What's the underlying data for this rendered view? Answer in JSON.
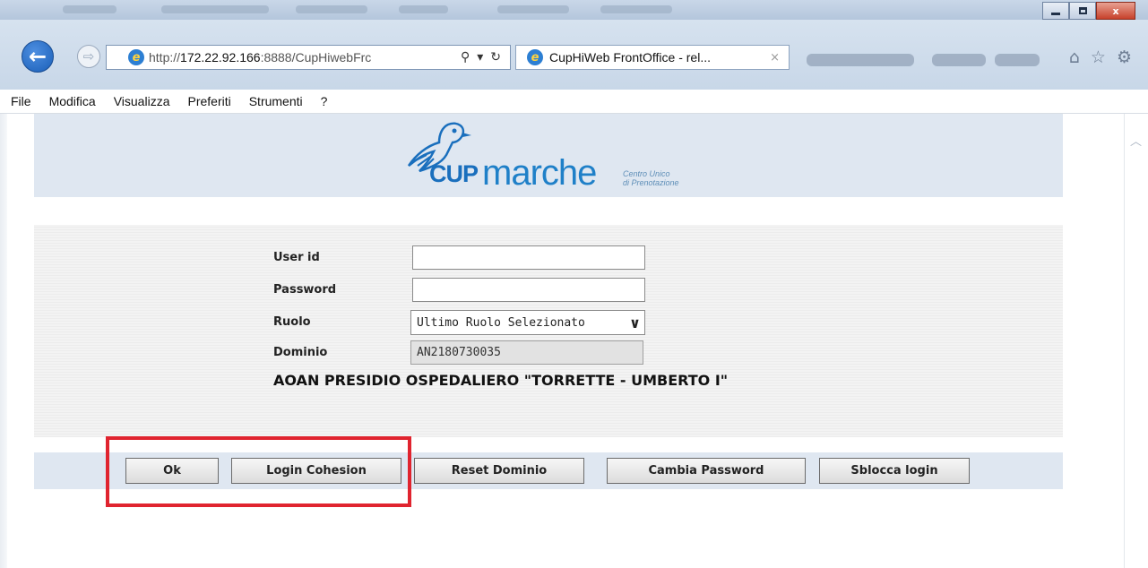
{
  "browser": {
    "address_prefix": "http://",
    "address_host": "172.22.92.166",
    "address_rest": ":8888/CupHiwebFrc",
    "search_icon": "search-icon",
    "tab_title": "CupHiWeb FrontOffice - rel...",
    "tab_close": "×",
    "win_close": "x"
  },
  "menu": {
    "items": [
      "File",
      "Modifica",
      "Visualizza",
      "Preferiti",
      "Strumenti",
      "?"
    ]
  },
  "logo": {
    "cup": "CUP",
    "marche": "marche",
    "sub_line1": "Centro Unico",
    "sub_line2": "di Prenotazione"
  },
  "form": {
    "user_label": "User id",
    "user_value": "",
    "password_label": "Password",
    "password_value": "",
    "role_label": "Ruolo",
    "role_value": "Ultimo Ruolo Selezionato",
    "domain_label": "Dominio",
    "domain_value": "AN2180730035",
    "facility": "AOAN PRESIDIO OSPEDALIERO \"TORRETTE - UMBERTO I\""
  },
  "buttons": {
    "ok": "Ok",
    "login_cohesion": "Login Cohesion",
    "reset_domain": "Reset Dominio",
    "change_password": "Cambia Password",
    "unlock_login": "Sblocca login"
  },
  "colors": {
    "highlight": "#e0242f",
    "header_band": "#dfe7f1",
    "logo_blue": "#1f80c8"
  }
}
